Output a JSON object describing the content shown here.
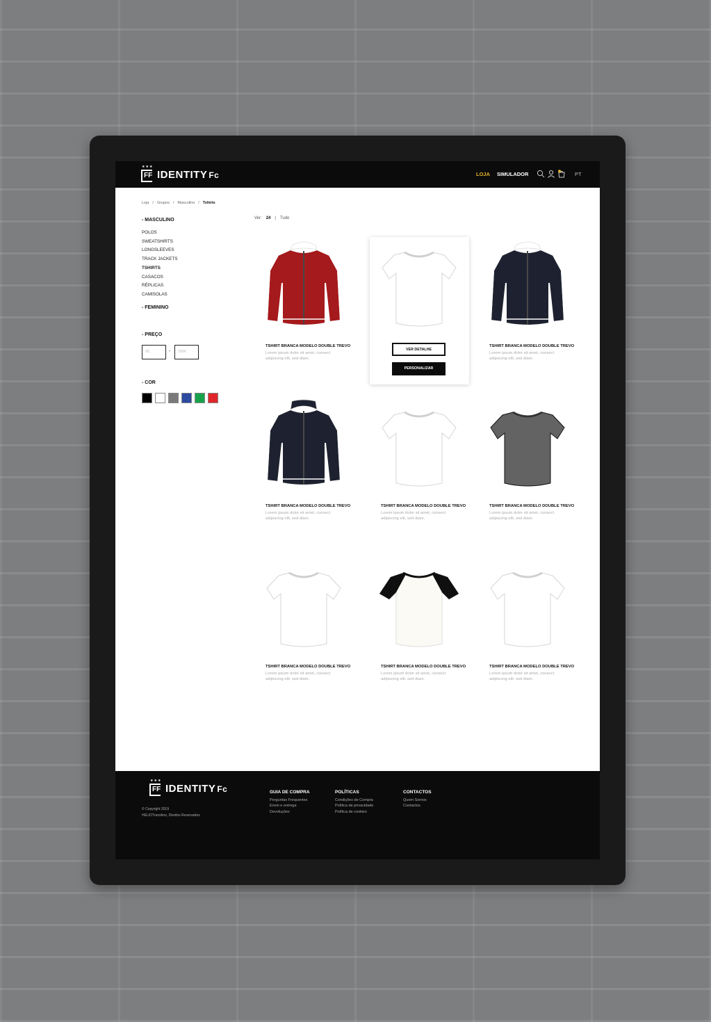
{
  "header": {
    "brand": "IDENTITY",
    "brand_suffix": "Fc",
    "logo_stars": "★★★",
    "logo_letters": "FF",
    "nav": [
      {
        "label": "LOJA"
      },
      {
        "label": "SIMULADOR"
      }
    ],
    "icons": [
      "search-icon",
      "user-icon",
      "cart-icon"
    ],
    "language": "PT",
    "colors": {
      "active_nav": "#e8b52a",
      "bar": "#0b0b0b"
    }
  },
  "breadcrumb": [
    {
      "label": "Loja"
    },
    {
      "label": "/"
    },
    {
      "label": "Grupos"
    },
    {
      "label": "/"
    },
    {
      "label": "Masculino"
    },
    {
      "label": "/"
    },
    {
      "label": "Tshirts"
    }
  ],
  "sidebar": {
    "masculino": "- MASCULINO",
    "items": [
      {
        "label": "POLOS"
      },
      {
        "label": "SWEATSHIRTS"
      },
      {
        "label": "LONGSLEEVES"
      },
      {
        "label": "TRACK JACKETS"
      },
      {
        "label": "TSHIRTS"
      },
      {
        "label": "CASACOS"
      },
      {
        "label": "RÉPLICAS"
      },
      {
        "label": "CAMISOLAS"
      }
    ],
    "active_item": "TSHIRTS",
    "feminino": "- FEMININO",
    "price_title": "- PREÇO",
    "price_min_placeholder": "0€",
    "price_separator": "-",
    "price_max_placeholder": "200€",
    "color_title": "- COR",
    "colors": [
      "#000000",
      "#ffffff",
      "#7a7a7a",
      "#2b4aa0",
      "#17a24a",
      "#e0262b"
    ]
  },
  "view": {
    "label": "Ver:",
    "count": "24",
    "separator": "|",
    "all": "Tudo"
  },
  "products": [
    {
      "title": "TSHIRT BRANCA MODELO DOUBLE TREVO",
      "desc": "Lorem ipsum dolor sit amet, consect adipiscing elit, sed diam.",
      "kind": "jacket",
      "color": "#a51a1c"
    },
    {
      "title": "",
      "desc": "",
      "kind": "tshirt",
      "color": "#ffffff",
      "highlight": true,
      "btn_detail": "VER DETALHE",
      "btn_custom": "PERSONALIZAR"
    },
    {
      "title": "TSHIRT BRANCA MODELO DOUBLE TREVO",
      "desc": "Lorem ipsum dolor sit amet, consect adipiscing elit, sed diam.",
      "kind": "jacket",
      "color": "#1e2230"
    },
    {
      "title": "TSHIRT BRANCA MODELO DOUBLE TREVO",
      "desc": "Lorem ipsum dolor sit amet, consect adipiscing elit, sed diam.",
      "kind": "jacket-collar",
      "color": "#1e2230"
    },
    {
      "title": "TSHIRT BRANCA MODELO DOUBLE TREVO",
      "desc": "Lorem ipsum dolor sit amet, consect adipiscing elit, sed diam.",
      "kind": "tshirt",
      "color": "#ffffff"
    },
    {
      "title": "TSHIRT BRANCA MODELO DOUBLE TREVO",
      "desc": "Lorem ipsum dolor sit amet, consect adipiscing elit, sed diam.",
      "kind": "tshirt",
      "color": "#636363"
    },
    {
      "title": "TSHIRT BRANCA MODELO DOUBLE TREVO",
      "desc": "Lorem ipsum dolor sit amet, consect adipiscing elit, sed diam.",
      "kind": "tshirt",
      "color": "#ffffff"
    },
    {
      "title": "TSHIRT BRANCA MODELO DOUBLE TREVO",
      "desc": "Lorem ipsum dolor sit amet, consect adipiscing elit, sed diam.",
      "kind": "raglan",
      "color": "#fbfaf5"
    },
    {
      "title": "TSHIRT BRANCA MODELO DOUBLE TREVO",
      "desc": "Lorem ipsum dolor sit amet, consect adipiscing elit, sed diam.",
      "kind": "tshirt",
      "color": "#ffffff"
    }
  ],
  "footer": {
    "copyright": "© Copyright 2019",
    "rights": "HELIOTransfers, Direitos Reservados",
    "columns": [
      {
        "title": "GUIA DE COMPRA",
        "links": [
          "Perguntas Frequentes",
          "Envio e entrega",
          "Devoluções"
        ]
      },
      {
        "title": "POLÍTICAS",
        "links": [
          "Condições de Compra",
          "Política de privacidade",
          "Política de cookies"
        ]
      },
      {
        "title": "CONTACTOS",
        "links": [
          "Quem Somos",
          "Contactos"
        ]
      }
    ]
  }
}
